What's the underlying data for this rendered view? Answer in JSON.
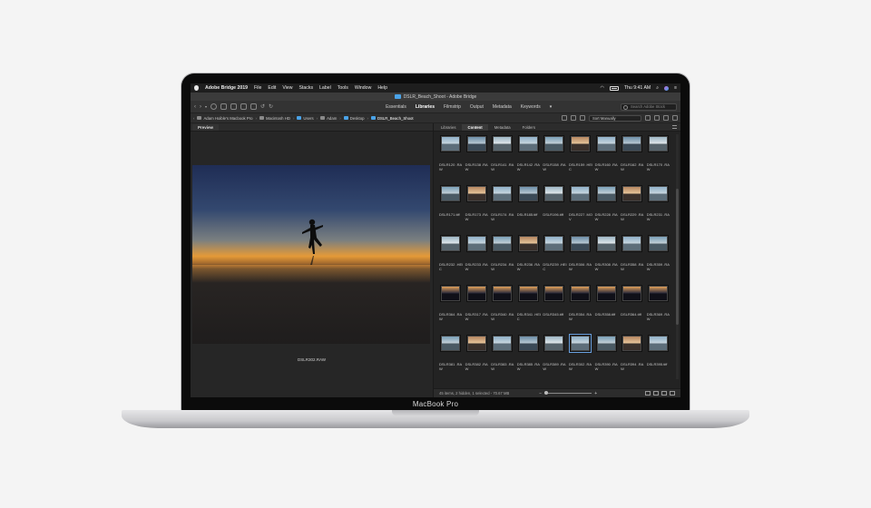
{
  "device": {
    "label": "MacBook Pro"
  },
  "menubar": {
    "app_name": "Adobe Bridge 2019",
    "items": [
      "File",
      "Edit",
      "View",
      "Stacks",
      "Label",
      "Tools",
      "Window",
      "Help"
    ],
    "clock": "Thu 9:41 AM"
  },
  "window": {
    "title": "DSLR_Beach_Shoot - Adobe Bridge"
  },
  "toolbar": {
    "workspaces": [
      "Essentials",
      "Libraries",
      "Filmstrip",
      "Output",
      "Metadata",
      "Keywords"
    ],
    "active_workspace": "Libraries",
    "search_placeholder": "Search Adobe Stock"
  },
  "pathbar": {
    "crumbs": [
      "Adam Hoible's Macbook Pro",
      "Macintosh HD",
      "Users",
      "Adam",
      "Desktop",
      "DSLR_Beach_Shoot"
    ],
    "sort_label": "Sort Manually"
  },
  "preview": {
    "tab": "Preview",
    "caption": "DSLR302.RAW"
  },
  "content": {
    "tabs": [
      "Libraries",
      "Content",
      "Metadata",
      "Folders"
    ],
    "active_tab": "Content",
    "files": [
      "DSLR120 .RAW",
      "DSLR138 .RAW",
      "DSLR141 .RAW",
      "DSLR142 .RAW",
      "DSLR158 .RAW",
      "DSLR159 .HEIC",
      "DSLR160 .RAW",
      "DSLR162 .RAW",
      "DSLR170 .RAW",
      "DSLR171.tiff",
      "DSLR173 .RAW",
      "DSLR174 .RAW",
      "DSLR185.tiff",
      "DSLR196.tiff",
      "DSLR227 .MOV",
      "DSLR228 .RAW",
      "DSLR229 .RAW",
      "DSLR231 .RAW",
      "DSLR232 .HEIC",
      "DSLR233 .RAW",
      "DSLR234 .RAW",
      "DSLR236 .RAW",
      "DSLR239 .HEIC",
      "DSLR306 .RAW",
      "DSLR308 .RAW",
      "DSLR358 .RAW",
      "DSLR359 .RAW",
      "DSLR364 .RAW",
      "DSLR317 .RAW",
      "DSLR340 .RAW",
      "DSLR341 .HEIC",
      "DSLR345.tiff",
      "DSLR354 .RAW",
      "DSLR358.tiff",
      "DSLR364.tiff",
      "DSLR369 .RAW",
      "DSLR381 .RAW",
      "DSLR382 .RAW",
      "DSLR383 .RAW",
      "DSLR385 .RAW",
      "DSLR389 .RAW",
      "DSLR302 .RAW",
      "DSLR390 .RAW",
      "DSLR394 .RAW",
      "DSLR395.tiff"
    ],
    "selected_file": "DSLR302 .RAW"
  },
  "status": {
    "text": "45 items, 2 hidden, 1 selected - 70.67 MB"
  }
}
